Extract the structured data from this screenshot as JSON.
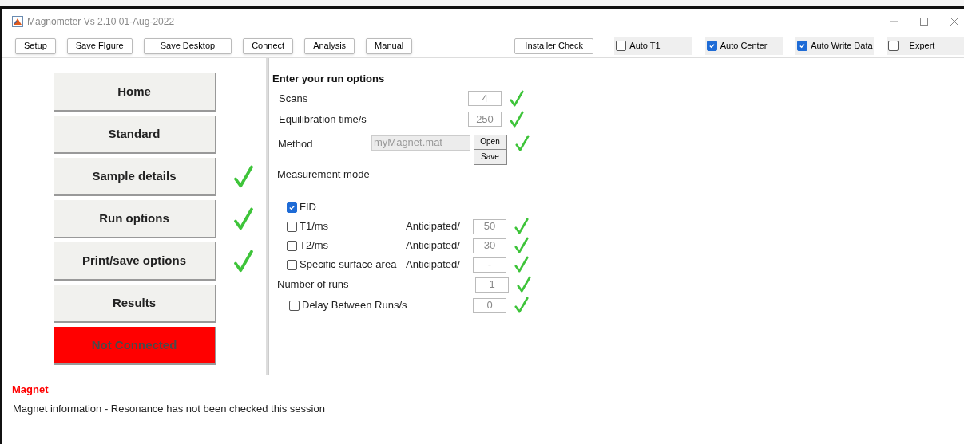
{
  "window": {
    "title": "Magnometer Vs 2.10  01-Aug-2022"
  },
  "toolbar": {
    "buttons": [
      "Setup",
      "Save FIgure",
      "Save Desktop",
      "Connect",
      "Analysis",
      "Manual"
    ],
    "installer_check": "Installer Check",
    "options": [
      {
        "label": "Auto T1",
        "checked": false
      },
      {
        "label": "Auto Center",
        "checked": true
      },
      {
        "label": "Auto Write Data",
        "checked": true
      },
      {
        "label": "Expert",
        "checked": false
      }
    ]
  },
  "nav": [
    {
      "label": "Home",
      "kind": "page",
      "done": false
    },
    {
      "label": "Standard",
      "kind": "page",
      "done": false
    },
    {
      "label": "Sample details",
      "kind": "page",
      "done": true
    },
    {
      "label": "Run options",
      "kind": "page",
      "done": true
    },
    {
      "label": "Print/save options",
      "kind": "page",
      "done": true
    },
    {
      "label": "Results",
      "kind": "page",
      "done": false
    },
    {
      "label": "Not Connected",
      "kind": "status",
      "done": false
    }
  ],
  "run_options": {
    "heading": "Enter your run options",
    "scans": {
      "label": "Scans",
      "value": "4",
      "valid": true
    },
    "equilibration": {
      "label": "Equilibration time/s",
      "value": "250",
      "valid": true
    },
    "method": {
      "label": "Method",
      "value": "myMagnet.mat",
      "open": "Open",
      "save": "Save",
      "valid": true
    },
    "measurement_mode": "Measurement mode",
    "modes": [
      {
        "label": "FID",
        "checked": true
      },
      {
        "label": "T1/ms",
        "checked": false,
        "anticipated": "Anticipated/",
        "value": "50",
        "valid": true
      },
      {
        "label": "T2/ms",
        "checked": false,
        "anticipated": "Anticipated/",
        "value": "30",
        "valid": true
      },
      {
        "label": "Specific surface area",
        "checked": false,
        "anticipated": "Anticipated/",
        "value": "-",
        "valid": true
      }
    ],
    "runs": {
      "label": "Number of runs",
      "value": "1",
      "valid": true
    },
    "delay": {
      "label": "Delay Between Runs/s",
      "checked": false,
      "value": "0",
      "valid": true
    }
  },
  "magnet": {
    "title": "Magnet",
    "info": "Magnet information - Resonance has not been checked this session"
  }
}
